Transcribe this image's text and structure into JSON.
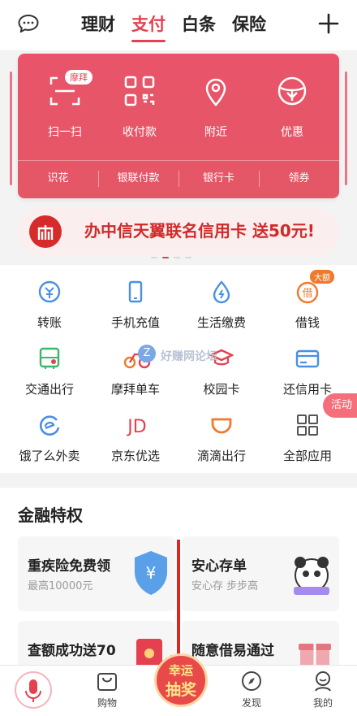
{
  "header": {
    "tabs": [
      "理财",
      "支付",
      "白条",
      "保险"
    ],
    "active_tab": 1
  },
  "quick_actions": [
    {
      "label": "扫一扫",
      "icon": "scan-icon"
    },
    {
      "label": "收付款",
      "icon": "qrcode-icon"
    },
    {
      "label": "附近",
      "icon": "location-pin-icon"
    },
    {
      "label": "优惠",
      "icon": "coupon-icon"
    }
  ],
  "quick_badge": "摩拜",
  "sub_actions": [
    "识花",
    "银联付款",
    "银行卡",
    "领券"
  ],
  "banner": {
    "text": "办中信天翼联名信用卡 送50元!"
  },
  "services": [
    {
      "label": "转账",
      "icon": "transfer-icon"
    },
    {
      "label": "手机充值",
      "icon": "phone-icon"
    },
    {
      "label": "生活缴费",
      "icon": "water-drop-icon"
    },
    {
      "label": "借钱",
      "icon": "borrow-icon"
    },
    {
      "label": "交通出行",
      "icon": "transport-icon"
    },
    {
      "label": "摩拜单车",
      "icon": "bike-icon"
    },
    {
      "label": "校园卡",
      "icon": "graduation-cap-icon"
    },
    {
      "label": "还信用卡",
      "icon": "credit-card-icon"
    },
    {
      "label": "饿了么外卖",
      "icon": "eleme-icon"
    },
    {
      "label": "京东优选",
      "icon": "jd-icon"
    },
    {
      "label": "滴滴出行",
      "icon": "didi-icon"
    },
    {
      "label": "全部应用",
      "icon": "grid-icon"
    }
  ],
  "services_badge": "大额",
  "float_action": "活动",
  "watermark": "好赚网论坛",
  "finance": {
    "title": "金融特权",
    "cards": [
      {
        "title": "重疾险免费领",
        "subtitle": "最高10000元"
      },
      {
        "title": "安心存单",
        "subtitle": "安心存 步步高"
      },
      {
        "title": "查额成功送70",
        "subtitle": ""
      },
      {
        "title": "随意借易通过",
        "subtitle": ""
      }
    ]
  },
  "tabbar": {
    "items": [
      {
        "label": "购物",
        "icon": "shopping-icon"
      },
      {
        "label": "发现",
        "icon": "compass-icon"
      },
      {
        "label": "我的",
        "icon": "profile-icon"
      }
    ],
    "center_line1": "幸运",
    "center_line2": "抽奖"
  },
  "colors": {
    "accent": "#e5404f",
    "card": "#e9546a",
    "arrow": "#e02424"
  }
}
